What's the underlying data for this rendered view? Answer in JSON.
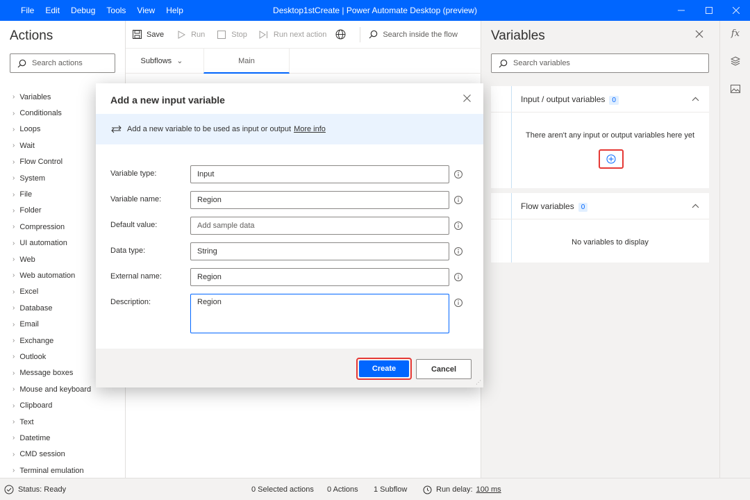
{
  "window": {
    "title": "Desktop1stCreate | Power Automate Desktop (preview)",
    "menu": [
      "File",
      "Edit",
      "Debug",
      "Tools",
      "View",
      "Help"
    ]
  },
  "actions_panel": {
    "title": "Actions",
    "search_placeholder": "Search actions",
    "items": [
      "Variables",
      "Conditionals",
      "Loops",
      "Wait",
      "Flow Control",
      "System",
      "File",
      "Folder",
      "Compression",
      "UI automation",
      "Web",
      "Web automation",
      "Excel",
      "Database",
      "Email",
      "Exchange",
      "Outlook",
      "Message boxes",
      "Mouse and keyboard",
      "Clipboard",
      "Text",
      "Datetime",
      "CMD session",
      "Terminal emulation"
    ]
  },
  "toolbar": {
    "save": "Save",
    "run": "Run",
    "stop": "Stop",
    "run_next": "Run next action",
    "search_placeholder": "Search inside the flow"
  },
  "tabs": {
    "subflows": "Subflows",
    "main": "Main"
  },
  "variables_panel": {
    "title": "Variables",
    "search_placeholder": "Search variables",
    "io_section": {
      "title": "Input / output variables",
      "count": "0",
      "empty": "There aren't any input or output variables here yet"
    },
    "flow_section": {
      "title": "Flow variables",
      "count": "0",
      "empty": "No variables to display"
    }
  },
  "dialog": {
    "title": "Add a new input variable",
    "info_text": "Add a new variable to be used as input or output",
    "info_link": "More info",
    "fields": [
      {
        "label": "Variable type:",
        "value": "Input"
      },
      {
        "label": "Variable name:",
        "value": "Region"
      },
      {
        "label": "Default value:",
        "value": "Add sample data"
      },
      {
        "label": "Data type:",
        "value": "String"
      },
      {
        "label": "External name:",
        "value": "Region"
      },
      {
        "label": "Description:",
        "value": "Region"
      }
    ],
    "create": "Create",
    "cancel": "Cancel"
  },
  "status_bar": {
    "status": "Status: Ready",
    "selected": "0 Selected actions",
    "actions": "0 Actions",
    "subflows": "1 Subflow",
    "run_delay_label": "Run delay:",
    "run_delay_value": "100 ms"
  },
  "colors": {
    "accent": "#0066ff",
    "highlight": "#e53935"
  }
}
